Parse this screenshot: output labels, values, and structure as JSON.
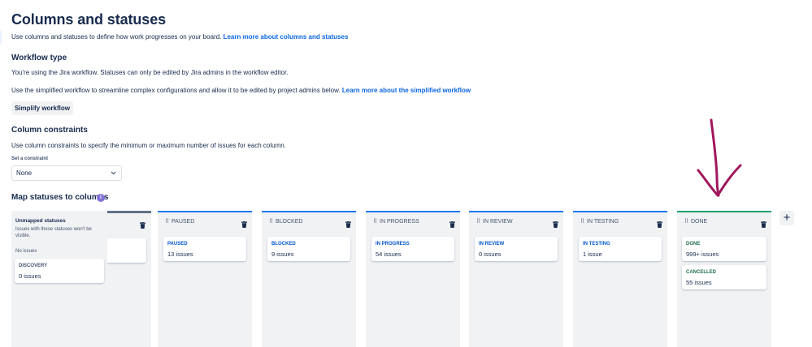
{
  "page_title": "Columns and statuses",
  "intro": {
    "text": "Use columns and statuses to define how work progresses on your board. ",
    "link": "Learn more about columns and statuses"
  },
  "workflow": {
    "heading": "Workflow type",
    "jira_text": "You're using the Jira workflow. Statuses can only be edited by Jira admins in the workflow editor.",
    "simplified_text": "Use the simplified workflow to streamline complex configurations and allow it to be edited by project admins below. ",
    "simplified_link": "Learn more about the simplified workflow",
    "button": "Simplify workflow"
  },
  "constraints": {
    "heading": "Column constraints",
    "text": "Use column constraints to specify the minimum or maximum number of issues for each column.",
    "select_label": "Set a constraint",
    "select_value": "None"
  },
  "map": {
    "heading": "Map statuses to columns",
    "info_icon": "i",
    "unmapped": {
      "title": "Unmapped statuses",
      "subtitle": "Issues with these statuses won't be visible.",
      "no_issues": "No issues",
      "status": "DISCOVERY",
      "count": "0 issues"
    },
    "columns": [
      {
        "name": "PAUSED",
        "status": "PAUSED",
        "count": "13 issues"
      },
      {
        "name": "BLOCKED",
        "status": "BLOCKED",
        "count": "9 issues"
      },
      {
        "name": "IN PROGRESS",
        "status": "IN PROGRESS",
        "count": "54 issues"
      },
      {
        "name": "IN REVIEW",
        "status": "IN REVIEW",
        "count": "0 issues"
      },
      {
        "name": "IN TESTING",
        "status": "IN TESTING",
        "count": "1 issue"
      },
      {
        "name": "DONE",
        "status": "DONE",
        "count": "999+ issues",
        "status2": "CANCELLED",
        "count2": "55 issues"
      }
    ],
    "add_column": "+"
  },
  "icons": {
    "trash": "trash-icon",
    "drag": "drag-handle-icon",
    "chevron": "chevron-down-icon",
    "annotation": "arrow-down-annotation"
  },
  "colors": {
    "accent_blue": "#1d7afc",
    "done_green": "#22a06b",
    "annotation_magenta": "#a1165d",
    "info_purple": "#8270db"
  }
}
